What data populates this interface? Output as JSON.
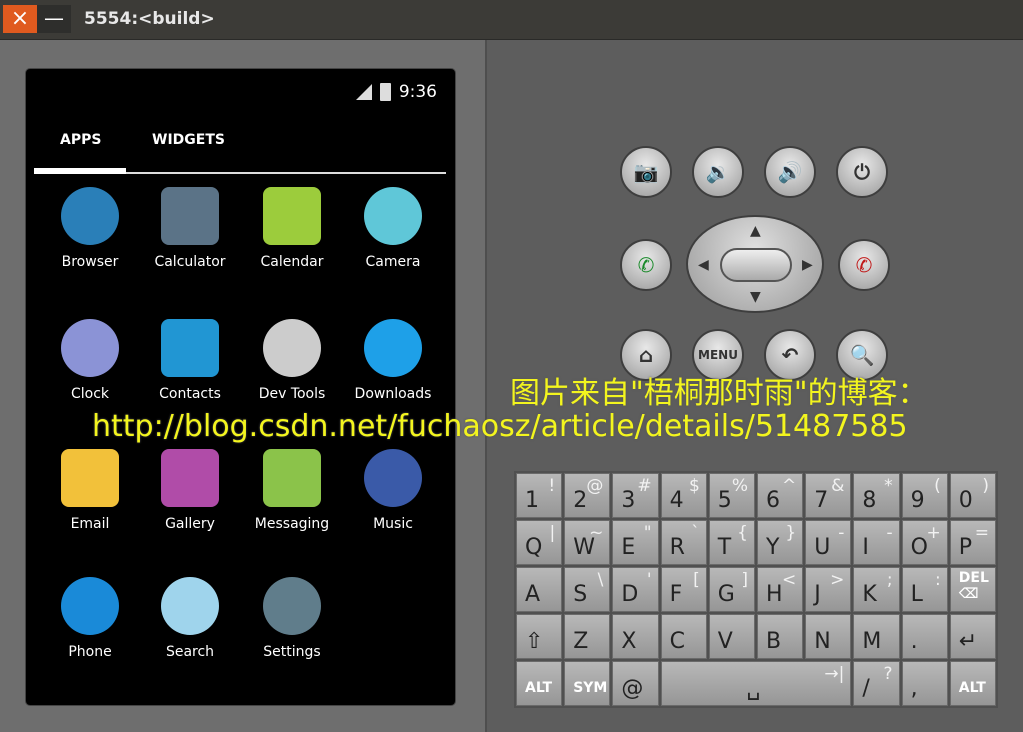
{
  "window": {
    "title": "5554:<build>",
    "close_icon": "×",
    "minimize_icon": "—"
  },
  "status_bar": {
    "time": "9:36",
    "signal_icon": "signal",
    "battery_icon": "battery-charging"
  },
  "tabs": [
    {
      "label": "APPS",
      "active": true
    },
    {
      "label": "WIDGETS",
      "active": false
    }
  ],
  "apps": [
    {
      "label": "Browser",
      "color": "#2a7fb8"
    },
    {
      "label": "Calculator",
      "color": "#5b7387"
    },
    {
      "label": "Calendar",
      "color": "#9ccc3c"
    },
    {
      "label": "Camera",
      "color": "#5fc7d8"
    },
    {
      "label": "Clock",
      "color": "#8b93d6"
    },
    {
      "label": "Contacts",
      "color": "#2196d3"
    },
    {
      "label": "Dev Tools",
      "color": "#cccccc"
    },
    {
      "label": "Downloads",
      "color": "#1ea0e8"
    },
    {
      "label": "Email",
      "color": "#f2c13a"
    },
    {
      "label": "Gallery",
      "color": "#b04ca8"
    },
    {
      "label": "Messaging",
      "color": "#8bc34a"
    },
    {
      "label": "Music",
      "color": "#3a5aa8"
    },
    {
      "label": "Phone",
      "color": "#1a8ad8"
    },
    {
      "label": "Search",
      "color": "#9fd4ec"
    },
    {
      "label": "Settings",
      "color": "#607d8b"
    }
  ],
  "controls": {
    "camera": "📷",
    "vol_down": "🔉",
    "vol_up": "🔊",
    "power": "⏻",
    "call": "✆",
    "end_call": "✆",
    "home": "⌂",
    "menu": "MENU",
    "back": "↶",
    "search": "🔍"
  },
  "keyboard": [
    [
      [
        "1",
        "!"
      ],
      [
        "2",
        "@"
      ],
      [
        "3",
        "#"
      ],
      [
        "4",
        "$"
      ],
      [
        "5",
        "%"
      ],
      [
        "6",
        "^"
      ],
      [
        "7",
        "&"
      ],
      [
        "8",
        "*"
      ],
      [
        "9",
        "("
      ],
      [
        "0",
        ")"
      ]
    ],
    [
      [
        "Q",
        "|"
      ],
      [
        "W",
        "~"
      ],
      [
        "E",
        "\""
      ],
      [
        "R",
        "`"
      ],
      [
        "T",
        "{"
      ],
      [
        "Y",
        "}"
      ],
      [
        "U",
        "-"
      ],
      [
        "I",
        "-"
      ],
      [
        "O",
        "+"
      ],
      [
        "P",
        "="
      ]
    ],
    [
      [
        "A",
        ""
      ],
      [
        "S",
        "\\"
      ],
      [
        "D",
        "'"
      ],
      [
        "F",
        "["
      ],
      [
        "G",
        "]"
      ],
      [
        "H",
        "<"
      ],
      [
        "J",
        ">"
      ],
      [
        "K",
        ";"
      ],
      [
        "L",
        ":"
      ],
      [
        "DEL ⌫",
        ""
      ]
    ],
    [
      [
        "⇧",
        ""
      ],
      [
        "Z",
        ""
      ],
      [
        "X",
        ""
      ],
      [
        "C",
        ""
      ],
      [
        "V",
        ""
      ],
      [
        "B",
        ""
      ],
      [
        "N",
        ""
      ],
      [
        "M",
        ""
      ],
      [
        ".",
        ""
      ],
      [
        "↵",
        ""
      ]
    ],
    [
      [
        "ALT",
        ""
      ],
      [
        "SYM",
        ""
      ],
      [
        "@",
        ""
      ],
      [
        "␣",
        "→|"
      ],
      [
        "/",
        "?"
      ],
      [
        ",",
        ""
      ],
      [
        "ALT",
        ""
      ]
    ]
  ],
  "watermark": {
    "line1": "图片来自\"梧桐那时雨\"的博客：",
    "line2": "http://blog.csdn.net/fuchaosz/article/details/51487585"
  }
}
